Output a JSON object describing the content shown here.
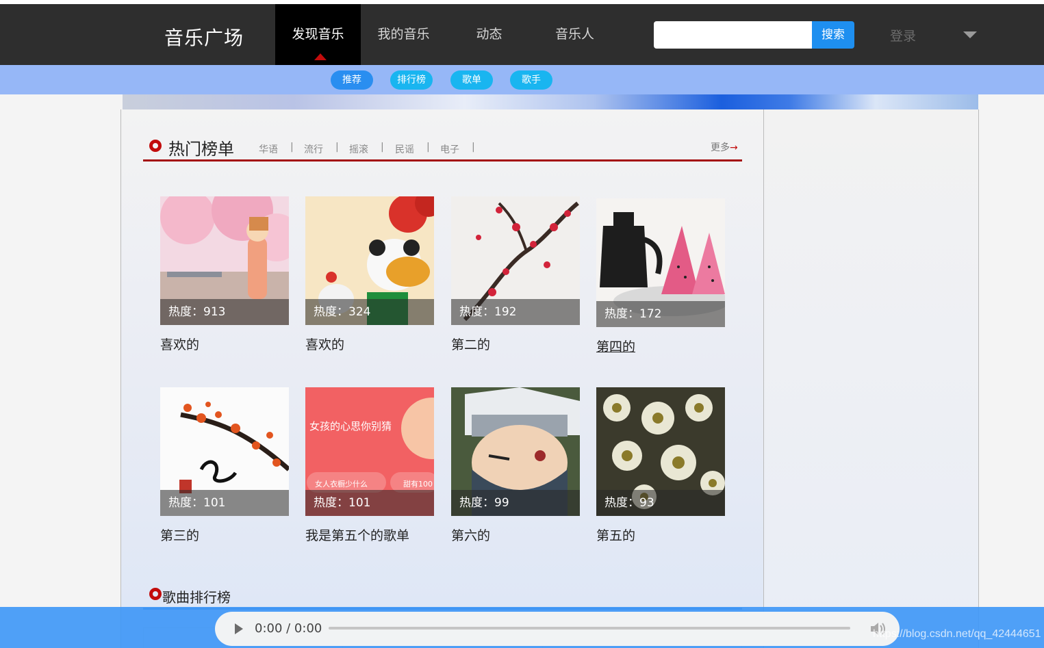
{
  "header": {
    "logo": "音乐广场",
    "nav": [
      "发现音乐",
      "我的音乐",
      "动态",
      "音乐人"
    ],
    "search_placeholder": "",
    "search_button": "搜索",
    "login": "登录"
  },
  "subnav": {
    "pills": [
      {
        "label": "推荐",
        "color": "#2a8ef0"
      },
      {
        "label": "排行榜",
        "color": "#19b5f0"
      },
      {
        "label": "歌单",
        "color": "#19b5f0"
      },
      {
        "label": "歌手",
        "color": "#19b5f0"
      }
    ]
  },
  "hot": {
    "title": "热门榜单",
    "categories": [
      "华语",
      "流行",
      "摇滚",
      "民谣",
      "电子"
    ],
    "separator": "|",
    "more": "更多",
    "more_arrow": "→"
  },
  "playlists": [
    {
      "heat": "热度：913",
      "name": "喜欢的",
      "icon": "sakura-girl-cover"
    },
    {
      "heat": "热度：324",
      "name": "喜欢的",
      "icon": "panda-new-year-cover"
    },
    {
      "heat": "热度：192",
      "name": "第二的",
      "icon": "plum-blossom-cover"
    },
    {
      "heat": "热度：172",
      "name": "第四的",
      "icon": "teapot-watermelon-cover"
    },
    {
      "heat": "热度：101",
      "name": "第三的",
      "icon": "plum-calligraphy-cover"
    },
    {
      "heat": "热度：101",
      "name": "我是第五个的歌单",
      "icon": "pink-banner-cover",
      "cover_text": "女孩的心思你别猜",
      "chips": [
        "女人衣橱少什么",
        "甜有100"
      ]
    },
    {
      "heat": "热度：99",
      "name": "第六的",
      "icon": "ninja-cover"
    },
    {
      "heat": "热度：93",
      "name": "第五的",
      "icon": "daisy-cover"
    }
  ],
  "ranking": {
    "title": "歌曲排行榜"
  },
  "player": {
    "time": "0:00 / 0:00"
  },
  "watermark": "https://blog.csdn.net/qq_42444651"
}
